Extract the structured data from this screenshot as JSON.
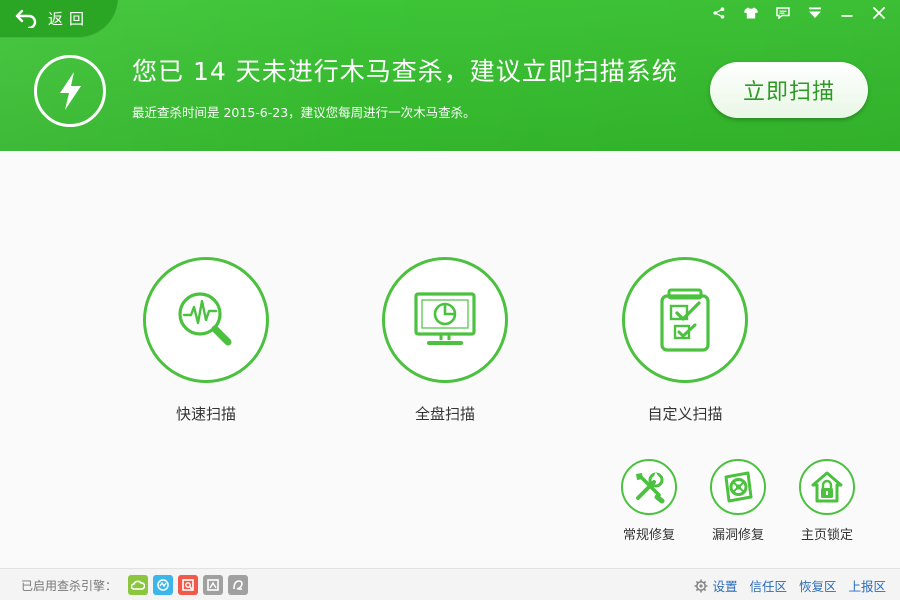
{
  "header": {
    "back_label": "返回",
    "headline": "您已 14 天未进行木马查杀，建议立即扫描系统",
    "subline": "最近查杀时间是 2015-6-23，建议您每周进行一次木马查杀。",
    "scan_now_label": "立即扫描",
    "window_controls": [
      "share-icon",
      "skin-icon",
      "message-icon",
      "menu-icon",
      "minimize-icon",
      "close-icon"
    ]
  },
  "main": {
    "scan_options": [
      {
        "label": "快速扫描",
        "icon": "pulse-magnifier-icon"
      },
      {
        "label": "全盘扫描",
        "icon": "monitor-icon"
      },
      {
        "label": "自定义扫描",
        "icon": "checklist-icon"
      }
    ],
    "tools": [
      {
        "label": "常规修复",
        "icon": "wrench-screwdriver-icon"
      },
      {
        "label": "漏洞修复",
        "icon": "patch-icon"
      },
      {
        "label": "主页锁定",
        "icon": "home-lock-icon"
      }
    ]
  },
  "footer": {
    "engines_label": "已启用查杀引擎：",
    "engines": [
      {
        "icon": "cloud-engine-icon",
        "color": "#8cc63f"
      },
      {
        "icon": "qvm-engine-icon",
        "color": "#3bb6e8"
      },
      {
        "icon": "system-engine-icon",
        "color": "#ef5a4a"
      },
      {
        "icon": "engine-four-icon",
        "color": "#a0a0a0"
      },
      {
        "icon": "engine-five-icon",
        "color": "#a0a0a0"
      }
    ],
    "links": {
      "settings": "设置",
      "trust_zone": "信任区",
      "restore_zone": "恢复区",
      "upload_zone": "上报区"
    }
  },
  "colors": {
    "brand_green": "#3ec437",
    "accent_green": "#4bc13f",
    "link_blue": "#2a6bbd"
  }
}
